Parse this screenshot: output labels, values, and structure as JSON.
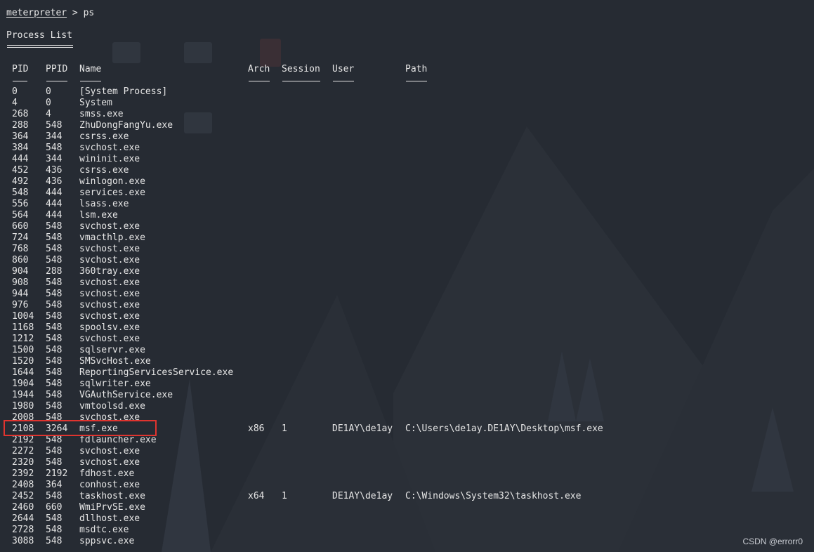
{
  "prompt": {
    "word": "meterpreter",
    "rest": " > ps"
  },
  "title": "Process List",
  "headers": {
    "pid": "PID",
    "ppid": "PPID",
    "name": "Name",
    "arch": "Arch",
    "session": "Session",
    "user": "User",
    "path": "Path"
  },
  "rows": [
    {
      "pid": "0",
      "ppid": "0",
      "name": "[System Process]",
      "arch": "",
      "session": "",
      "user": "",
      "path": ""
    },
    {
      "pid": "4",
      "ppid": "0",
      "name": "System",
      "arch": "",
      "session": "",
      "user": "",
      "path": ""
    },
    {
      "pid": "268",
      "ppid": "4",
      "name": "smss.exe",
      "arch": "",
      "session": "",
      "user": "",
      "path": ""
    },
    {
      "pid": "288",
      "ppid": "548",
      "name": "ZhuDongFangYu.exe",
      "arch": "",
      "session": "",
      "user": "",
      "path": ""
    },
    {
      "pid": "364",
      "ppid": "344",
      "name": "csrss.exe",
      "arch": "",
      "session": "",
      "user": "",
      "path": ""
    },
    {
      "pid": "384",
      "ppid": "548",
      "name": "svchost.exe",
      "arch": "",
      "session": "",
      "user": "",
      "path": ""
    },
    {
      "pid": "444",
      "ppid": "344",
      "name": "wininit.exe",
      "arch": "",
      "session": "",
      "user": "",
      "path": ""
    },
    {
      "pid": "452",
      "ppid": "436",
      "name": "csrss.exe",
      "arch": "",
      "session": "",
      "user": "",
      "path": ""
    },
    {
      "pid": "492",
      "ppid": "436",
      "name": "winlogon.exe",
      "arch": "",
      "session": "",
      "user": "",
      "path": ""
    },
    {
      "pid": "548",
      "ppid": "444",
      "name": "services.exe",
      "arch": "",
      "session": "",
      "user": "",
      "path": ""
    },
    {
      "pid": "556",
      "ppid": "444",
      "name": "lsass.exe",
      "arch": "",
      "session": "",
      "user": "",
      "path": ""
    },
    {
      "pid": "564",
      "ppid": "444",
      "name": "lsm.exe",
      "arch": "",
      "session": "",
      "user": "",
      "path": ""
    },
    {
      "pid": "660",
      "ppid": "548",
      "name": "svchost.exe",
      "arch": "",
      "session": "",
      "user": "",
      "path": ""
    },
    {
      "pid": "724",
      "ppid": "548",
      "name": "vmacthlp.exe",
      "arch": "",
      "session": "",
      "user": "",
      "path": ""
    },
    {
      "pid": "768",
      "ppid": "548",
      "name": "svchost.exe",
      "arch": "",
      "session": "",
      "user": "",
      "path": ""
    },
    {
      "pid": "860",
      "ppid": "548",
      "name": "svchost.exe",
      "arch": "",
      "session": "",
      "user": "",
      "path": ""
    },
    {
      "pid": "904",
      "ppid": "288",
      "name": "360tray.exe",
      "arch": "",
      "session": "",
      "user": "",
      "path": ""
    },
    {
      "pid": "908",
      "ppid": "548",
      "name": "svchost.exe",
      "arch": "",
      "session": "",
      "user": "",
      "path": ""
    },
    {
      "pid": "944",
      "ppid": "548",
      "name": "svchost.exe",
      "arch": "",
      "session": "",
      "user": "",
      "path": ""
    },
    {
      "pid": "976",
      "ppid": "548",
      "name": "svchost.exe",
      "arch": "",
      "session": "",
      "user": "",
      "path": ""
    },
    {
      "pid": "1004",
      "ppid": "548",
      "name": "svchost.exe",
      "arch": "",
      "session": "",
      "user": "",
      "path": ""
    },
    {
      "pid": "1168",
      "ppid": "548",
      "name": "spoolsv.exe",
      "arch": "",
      "session": "",
      "user": "",
      "path": ""
    },
    {
      "pid": "1212",
      "ppid": "548",
      "name": "svchost.exe",
      "arch": "",
      "session": "",
      "user": "",
      "path": ""
    },
    {
      "pid": "1500",
      "ppid": "548",
      "name": "sqlservr.exe",
      "arch": "",
      "session": "",
      "user": "",
      "path": ""
    },
    {
      "pid": "1520",
      "ppid": "548",
      "name": "SMSvcHost.exe",
      "arch": "",
      "session": "",
      "user": "",
      "path": ""
    },
    {
      "pid": "1644",
      "ppid": "548",
      "name": "ReportingServicesService.exe",
      "arch": "",
      "session": "",
      "user": "",
      "path": ""
    },
    {
      "pid": "1904",
      "ppid": "548",
      "name": "sqlwriter.exe",
      "arch": "",
      "session": "",
      "user": "",
      "path": ""
    },
    {
      "pid": "1944",
      "ppid": "548",
      "name": "VGAuthService.exe",
      "arch": "",
      "session": "",
      "user": "",
      "path": ""
    },
    {
      "pid": "1980",
      "ppid": "548",
      "name": "vmtoolsd.exe",
      "arch": "",
      "session": "",
      "user": "",
      "path": ""
    },
    {
      "pid": "2008",
      "ppid": "548",
      "name": "svchost.exe",
      "arch": "",
      "session": "",
      "user": "",
      "path": ""
    },
    {
      "pid": "2108",
      "ppid": "3264",
      "name": "msf.exe",
      "arch": "x86",
      "session": "1",
      "user": "DE1AY\\de1ay",
      "path": "C:\\Users\\de1ay.DE1AY\\Desktop\\msf.exe"
    },
    {
      "pid": "2192",
      "ppid": "548",
      "name": "fdlauncher.exe",
      "arch": "",
      "session": "",
      "user": "",
      "path": ""
    },
    {
      "pid": "2272",
      "ppid": "548",
      "name": "svchost.exe",
      "arch": "",
      "session": "",
      "user": "",
      "path": ""
    },
    {
      "pid": "2320",
      "ppid": "548",
      "name": "svchost.exe",
      "arch": "",
      "session": "",
      "user": "",
      "path": ""
    },
    {
      "pid": "2392",
      "ppid": "2192",
      "name": "fdhost.exe",
      "arch": "",
      "session": "",
      "user": "",
      "path": ""
    },
    {
      "pid": "2408",
      "ppid": "364",
      "name": "conhost.exe",
      "arch": "",
      "session": "",
      "user": "",
      "path": ""
    },
    {
      "pid": "2452",
      "ppid": "548",
      "name": "taskhost.exe",
      "arch": "x64",
      "session": "1",
      "user": "DE1AY\\de1ay",
      "path": "C:\\Windows\\System32\\taskhost.exe"
    },
    {
      "pid": "2460",
      "ppid": "660",
      "name": "WmiPrvSE.exe",
      "arch": "",
      "session": "",
      "user": "",
      "path": ""
    },
    {
      "pid": "2644",
      "ppid": "548",
      "name": "dllhost.exe",
      "arch": "",
      "session": "",
      "user": "",
      "path": ""
    },
    {
      "pid": "2728",
      "ppid": "548",
      "name": "msdtc.exe",
      "arch": "",
      "session": "",
      "user": "",
      "path": ""
    },
    {
      "pid": "3088",
      "ppid": "548",
      "name": "sppsvc.exe",
      "arch": "",
      "session": "",
      "user": "",
      "path": ""
    }
  ],
  "watermark": "CSDN @errorr0",
  "colors": {
    "background": "#262b33",
    "text": "#e6e6e6",
    "highlight": "#e0342f"
  }
}
